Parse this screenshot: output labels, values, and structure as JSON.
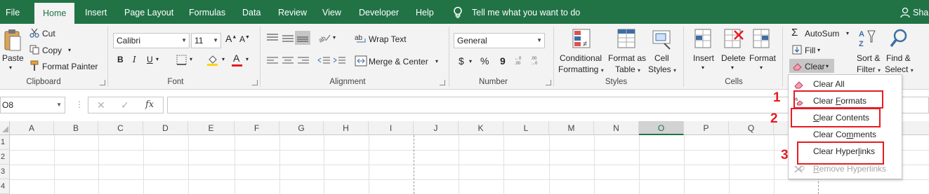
{
  "tabs": [
    "File",
    "Home",
    "Insert",
    "Page Layout",
    "Formulas",
    "Data",
    "Review",
    "View",
    "Developer",
    "Help"
  ],
  "active_tab": "Home",
  "tell_me": "Tell me what you want to do",
  "user": "Shar",
  "clipboard": {
    "paste": "Paste",
    "cut": "Cut",
    "copy": "Copy",
    "format_painter": "Format Painter",
    "group": "Clipboard"
  },
  "font": {
    "family": "Calibri",
    "size": "11",
    "bold": "B",
    "italic": "I",
    "underline": "U",
    "color_letter": "A",
    "group": "Font"
  },
  "alignment": {
    "wrap_text": "Wrap Text",
    "merge_center": "Merge & Center",
    "group": "Alignment"
  },
  "number": {
    "format": "General",
    "currency": "$",
    "percent": "%",
    "comma": "9",
    "inc_dec": ".00",
    "group": "Number"
  },
  "styles": {
    "conditional_1": "Conditional",
    "conditional_2": "Formatting",
    "format_table_1": "Format as",
    "format_table_2": "Table",
    "cell_styles_1": "Cell",
    "cell_styles_2": "Styles",
    "group": "Styles"
  },
  "cells": {
    "insert": "Insert",
    "delete": "Delete",
    "format": "Format",
    "group": "Cells"
  },
  "editing": {
    "autosum": "AutoSum",
    "fill": "Fill",
    "clear": "Clear",
    "sort_1": "Sort &",
    "sort_2": "Filter",
    "find_1": "Find &",
    "find_2": "Select"
  },
  "formula_bar": {
    "name_box": "O8",
    "fx": "fx",
    "cancel": "✕",
    "enter": "✓",
    "dots": "⋮"
  },
  "columns": [
    "A",
    "B",
    "C",
    "D",
    "E",
    "F",
    "G",
    "H",
    "I",
    "J",
    "K",
    "L",
    "M",
    "N",
    "O",
    "P",
    "Q"
  ],
  "selected_column": "O",
  "rows": [
    "1",
    "2",
    "3",
    "4"
  ],
  "clear_menu": {
    "clear_all": "Clear All",
    "clear_formats": {
      "pre": "Clear ",
      "u": "F",
      "post": "ormats"
    },
    "clear_contents": {
      "pre": "",
      "u": "C",
      "post": "lear Contents"
    },
    "clear_comments": {
      "pre": "Clear Co",
      "u": "m",
      "post": "ments"
    },
    "clear_hyperlinks": {
      "pre": "Clear Hyper",
      "u": "l",
      "post": "inks"
    },
    "remove_hyperlinks": {
      "pre": "",
      "u": "R",
      "post": "emove Hyperlinks"
    }
  },
  "annotations": [
    "1",
    "2",
    "3"
  ],
  "colors": {
    "accent": "#217346",
    "highlight": "#e51c23",
    "font_color": "#e51c23",
    "fill_color": "#ffd400"
  }
}
